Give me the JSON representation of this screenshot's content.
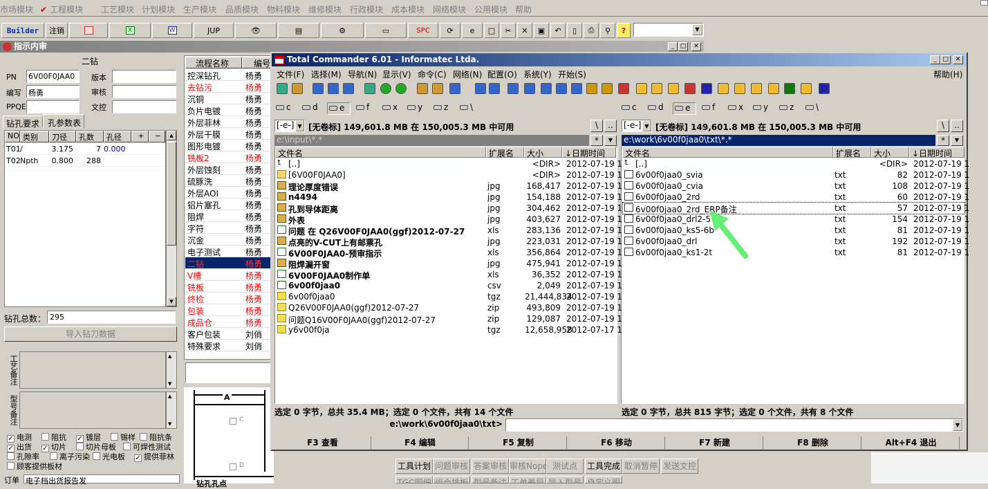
{
  "app_menu": [
    "市场模块",
    "工程模块",
    "工艺模块",
    "计划模块",
    "生产模块",
    "品质模块",
    "物料模块",
    "维修模块",
    "行政模块",
    "成本模块",
    "网络模块",
    "公用模块",
    "帮助"
  ],
  "toolbar": {
    "builder": "Builder",
    "logout": "注销",
    "jup": "JUP",
    "spc": "SPC"
  },
  "left": {
    "title": "指示内审",
    "section": "二钻",
    "pn_label": "PN",
    "pn_value": "6V00F0JAA0",
    "version_label": "版本",
    "writer_label": "编写",
    "writer_value": "杨勇",
    "review_label": "审核",
    "ppqe_label": "PPQE",
    "text_review_label": "文控",
    "tab1": "钻孔要求",
    "tab2": "孔参数表",
    "cols": [
      "NO",
      "类别",
      "刀径",
      "孔数",
      "孔径",
      "+",
      "−"
    ],
    "rows": [
      [
        "T01",
        "/",
        "3.175",
        "7",
        "0.000"
      ],
      [
        "T02",
        "Npth",
        "0.800",
        "288",
        ""
      ]
    ],
    "total_label": "钻孔总数：",
    "total_value": "295",
    "import_btn": "导入钻刀数据",
    "note1": "工艺备注",
    "note2": "型号备注",
    "checks": [
      {
        "label": "电测",
        "checked": true
      },
      {
        "label": "阻抗",
        "checked": false
      },
      {
        "label": "镀层",
        "checked": true
      },
      {
        "label": "锡样",
        "checked": false
      },
      {
        "label": "阻抗条",
        "checked": false
      },
      {
        "label": "出货",
        "checked": true
      },
      {
        "label": "切片",
        "checked": true
      },
      {
        "label": "切片母板",
        "checked": false
      },
      {
        "label": "可焊性测试",
        "checked": false
      },
      {
        "label": "孔隙率",
        "checked": false
      },
      {
        "label": "离子污染",
        "checked": false
      },
      {
        "label": "光电板",
        "checked": false
      },
      {
        "label": "提供菲林",
        "checked": true
      },
      {
        "label": "顾客提供板材",
        "checked": false
      }
    ],
    "bottom_left": "订单",
    "bottom_text": "电子档出货报告发"
  },
  "process": {
    "headers": [
      "流程名称",
      "编号"
    ],
    "rows": [
      {
        "name": "控深钻孔",
        "who": "杨勇",
        "red": false
      },
      {
        "name": "去钻污",
        "who": "杨勇",
        "red": true
      },
      {
        "name": "沉铜",
        "who": "杨勇",
        "red": false
      },
      {
        "name": "负片电镀",
        "who": "杨勇",
        "red": false
      },
      {
        "name": "外层菲林",
        "who": "杨勇",
        "red": false
      },
      {
        "name": "外层干膜",
        "who": "杨勇",
        "red": false
      },
      {
        "name": "图形电镀",
        "who": "杨勇",
        "red": false
      },
      {
        "name": "铣板2",
        "who": "杨勇",
        "red": true
      },
      {
        "name": "外层蚀刻",
        "who": "杨勇",
        "red": false
      },
      {
        "name": "硫豚洗",
        "who": "杨勇",
        "red": false
      },
      {
        "name": "外层AOI",
        "who": "杨勇",
        "red": false
      },
      {
        "name": "铝片塞孔",
        "who": "杨勇",
        "red": false
      },
      {
        "name": "阻焊",
        "who": "杨勇",
        "red": false
      },
      {
        "name": "字符",
        "who": "杨勇",
        "red": false
      },
      {
        "name": "沉金",
        "who": "杨勇",
        "red": false
      },
      {
        "name": "电子测试",
        "who": "杨勇",
        "red": false
      },
      {
        "name": "二钻",
        "who": "杨勇",
        "red": true,
        "selected": true
      },
      {
        "name": "V槽",
        "who": "杨勇",
        "red": true
      },
      {
        "name": "铣板",
        "who": "杨勇",
        "red": true
      },
      {
        "name": "终检",
        "who": "杨勇",
        "red": true
      },
      {
        "name": "包装",
        "who": "杨勇",
        "red": true
      },
      {
        "name": "成品仓",
        "who": "杨勇",
        "red": true
      },
      {
        "name": "客户包装",
        "who": "刘俏",
        "red": false
      },
      {
        "name": "特殊要求",
        "who": "刘俏",
        "red": false
      }
    ],
    "drawing_label": "A",
    "drawing_c": "C",
    "drawing_d": "D",
    "drawing_caption": "钻孔孔点"
  },
  "bottom_buttons": [
    "工具计划",
    "问题审核",
    "答案审核",
    "审核Nope",
    "测试点",
    "工具完成",
    "取消暂停",
    "发送文控"
  ],
  "bottom_buttons2": [
    "TGC明细",
    "组合排板",
    "型号备注",
    "工单差异",
    "导入型号",
    "自定义图"
  ],
  "tc": {
    "title": "Total Commander 6.01 - Informatec Ltda.",
    "menu": [
      "文件(F)",
      "选择(M)",
      "导航(N)",
      "显示(V)",
      "命令(C)",
      "网络(N)",
      "配置(O)",
      "系统(Y)",
      "开始(S)"
    ],
    "help": "帮助(H)",
    "drives": [
      "c",
      "d",
      "e",
      "f",
      "x",
      "y",
      "z",
      "\\"
    ],
    "left": {
      "drive": "[-e-]",
      "info": "[无卷标]  149,601.8 MB 在 150,005.3 MB 中可用",
      "path": "e:\\input\\*.*",
      "cols": [
        "文件名",
        "扩展名",
        "大小",
        "↓日期时间"
      ],
      "files": [
        {
          "name": "[..]",
          "ext": "",
          "size": "<DIR>",
          "date": "2012-07-19 1",
          "icon": "up"
        },
        {
          "name": "[6V00F0JAA0]",
          "ext": "",
          "size": "<DIR>",
          "date": "2012-07-19 1",
          "icon": "folder"
        },
        {
          "name": "理论厚度错误",
          "ext": "jpg",
          "size": "168,417",
          "date": "2012-07-19 1",
          "icon": "jpg"
        },
        {
          "name": "n4494",
          "ext": "jpg",
          "size": "154,188",
          "date": "2012-07-19 1",
          "icon": "jpg"
        },
        {
          "name": "孔到导体距离",
          "ext": "jpg",
          "size": "304,462",
          "date": "2012-07-19 1",
          "icon": "jpg"
        },
        {
          "name": "外表",
          "ext": "jpg",
          "size": "403,627",
          "date": "2012-07-19 1",
          "icon": "jpg"
        },
        {
          "name": "问题 在 Q26V00F0JAA0(ggf)2012-07-27",
          "ext": "xls",
          "size": "283,136",
          "date": "2012-07-19 1",
          "icon": "xls"
        },
        {
          "name": "点亮的V-CUT上有邮票孔",
          "ext": "jpg",
          "size": "223,031",
          "date": "2012-07-19 1",
          "icon": "jpg"
        },
        {
          "name": "6V00F0JAA0-预审指示",
          "ext": "xls",
          "size": "356,864",
          "date": "2012-07-19 1",
          "icon": "xls"
        },
        {
          "name": "阻焊漏开窗",
          "ext": "jpg",
          "size": "475,941",
          "date": "2012-07-19 1",
          "icon": "jpg"
        },
        {
          "name": "6V00F0JAA0制作单",
          "ext": "xls",
          "size": "36,352",
          "date": "2012-07-19 1",
          "icon": "xls"
        },
        {
          "name": "6v00f0jaa0",
          "ext": "csv",
          "size": "2,049",
          "date": "2012-07-19 1",
          "icon": "xls"
        },
        {
          "name": "6v00f0jaa0",
          "ext": "tgz",
          "size": "21,444,834",
          "date": "2012-07-19 1",
          "icon": "zip"
        },
        {
          "name": "Q26V00F0JAA0(ggf)2012-07-27",
          "ext": "zip",
          "size": "493,809",
          "date": "2012-07-19 1",
          "icon": "zip"
        },
        {
          "name": "问题Q16V00F0JAA0(ggf)2012-07-27",
          "ext": "zip",
          "size": "129,087",
          "date": "2012-07-19 1",
          "icon": "zip"
        },
        {
          "name": "y6v00f0ja",
          "ext": "tgz",
          "size": "12,658,958",
          "date": "2012-07-17 1",
          "icon": "zip"
        }
      ],
      "status": "选定 0 字节，总共 35.4 MB；选定 0 个文件，共有 14 个文件"
    },
    "right": {
      "drive": "[-e-]",
      "info": "[无卷标]  149,601.8 MB 在 150,005.3 MB 中可用",
      "path": "e:\\work\\6v00f0jaa0\\txt\\*.*",
      "cols": [
        "文件名",
        "扩展名",
        "大小",
        "↓日期时间"
      ],
      "files": [
        {
          "name": "[..]",
          "ext": "",
          "size": "<DIR>",
          "date": "2012-07-19 1",
          "icon": "up"
        },
        {
          "name": "6v00f0jaa0_svia",
          "ext": "txt",
          "size": "82",
          "date": "2012-07-19 1",
          "icon": "txt"
        },
        {
          "name": "6v00f0jaa0_cvia",
          "ext": "txt",
          "size": "108",
          "date": "2012-07-19 1",
          "icon": "txt"
        },
        {
          "name": "6v00f0jaa0_2rd",
          "ext": "txt",
          "size": "60",
          "date": "2012-07-19 1",
          "icon": "txt"
        },
        {
          "name": "6v00f0jaa0_2rd_ERP备注",
          "ext": "txt",
          "size": "57",
          "date": "2012-07-19 1",
          "icon": "txt",
          "focused": true
        },
        {
          "name": "6v00f0jaa0_drl2-5",
          "ext": "txt",
          "size": "154",
          "date": "2012-07-19 1",
          "icon": "txt"
        },
        {
          "name": "6v00f0jaa0_ks5-6b",
          "ext": "txt",
          "size": "81",
          "date": "2012-07-19 1",
          "icon": "txt"
        },
        {
          "name": "6v00f0jaa0_drl",
          "ext": "txt",
          "size": "192",
          "date": "2012-07-19 1",
          "icon": "txt"
        },
        {
          "name": "6v00f0jaa0_ks1-2t",
          "ext": "txt",
          "size": "81",
          "date": "2012-07-19 1",
          "icon": "txt"
        }
      ],
      "status": "选定 0 字节，总共 815 字节；选定 0 个文件，共有 8 个文件"
    },
    "cmd_path": "e:\\work\\6v00f0jaa0\\txt>",
    "fkeys": [
      "F3 查看",
      "F4 编辑",
      "F5 复制",
      "F6 移动",
      "F7 新建",
      "F8 删除",
      "Alt+F4 退出"
    ]
  },
  "colors": {
    "tc_title": "#0a246a",
    "red_text": "#ff0000",
    "select_bg": "#0a246a",
    "arrow": "#66ee77"
  }
}
